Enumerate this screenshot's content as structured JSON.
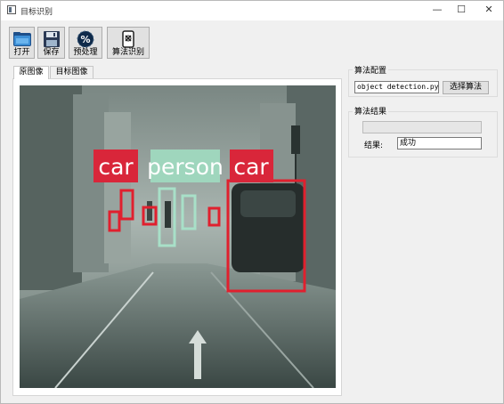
{
  "window": {
    "title": "目标识别",
    "controls": {
      "minimize": "—",
      "maximize": "☐",
      "close": "✕"
    }
  },
  "toolbar": {
    "buttons": [
      {
        "label": "打开",
        "icon": "folder-icon"
      },
      {
        "label": "保存",
        "icon": "floppy-disk-icon"
      },
      {
        "label": "预处理",
        "icon": "percent-badge-icon"
      },
      {
        "label": "算法识别",
        "icon": "phone-scan-icon"
      }
    ]
  },
  "tabs": [
    {
      "label": "原图像",
      "active": true
    },
    {
      "label": "目标图像",
      "active": false
    }
  ],
  "scene": {
    "detections": [
      {
        "label": "car",
        "color": "#d9263a"
      },
      {
        "label": "person",
        "color": "#9fd6bd"
      },
      {
        "label": "car",
        "color": "#d9263a"
      }
    ]
  },
  "algo_config": {
    "title": "算法配置",
    "file_value": "object detection.py",
    "select_button": "选择算法"
  },
  "algo_result": {
    "title": "算法结果",
    "progress": 0,
    "result_label": "结果:",
    "result_value": "成功"
  },
  "colors": {
    "window_bg": "#f0f0f0",
    "box_red": "#e0202e",
    "box_teal": "#a8e0c8",
    "label_red": "#d9263a",
    "label_teal": "#9fd6bd"
  }
}
